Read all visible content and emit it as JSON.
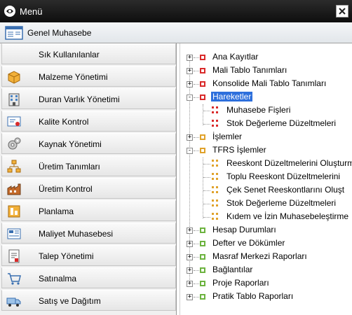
{
  "window": {
    "title": "Menü"
  },
  "header": {
    "title": "Genel Muhasebe",
    "icon": "ledger-icon"
  },
  "left_menu": {
    "items": [
      {
        "label": "Sık Kullanılanlar",
        "icon": ""
      },
      {
        "label": "Malzeme Yönetimi",
        "icon": "box-icon"
      },
      {
        "label": "Duran Varlık Yönetimi",
        "icon": "building-icon"
      },
      {
        "label": "Kalite Kontrol",
        "icon": "certificate-icon"
      },
      {
        "label": "Kaynak Yönetimi",
        "icon": "gears-icon"
      },
      {
        "label": "Üretim Tanımları",
        "icon": "flowchart-icon"
      },
      {
        "label": "Üretim Kontrol",
        "icon": "factory-icon"
      },
      {
        "label": "Planlama",
        "icon": "planning-icon"
      },
      {
        "label": "Maliyet Muhasebesi",
        "icon": "calculator-icon"
      },
      {
        "label": "Talep Yönetimi",
        "icon": "request-form-icon"
      },
      {
        "label": "Satınalma",
        "icon": "cart-icon"
      },
      {
        "label": "Satış ve Dağıtım",
        "icon": "truck-icon"
      }
    ]
  },
  "tree": {
    "nodes": [
      {
        "label": "Ana Kayıtlar",
        "expander": "+",
        "color": "#d92a2a"
      },
      {
        "label": "Mali Tablo Tanımları",
        "expander": "+",
        "color": "#d92a2a"
      },
      {
        "label": "Konsolide Mali Tablo Tanımları",
        "expander": "+",
        "color": "#d92a2a"
      },
      {
        "label": "Hareketler",
        "expander": "-",
        "color": "#d92a2a",
        "selected": true
      },
      {
        "label": "Muhasebe Fişleri",
        "leaf": true,
        "color": "#d92a2a"
      },
      {
        "label": "Stok Değerleme Düzeltmeleri",
        "leaf": true,
        "color": "#d92a2a"
      },
      {
        "label": "İşlemler",
        "expander": "+",
        "color": "#e0a22b"
      },
      {
        "label": "TFRS İşlemler",
        "expander": "-",
        "color": "#e0a22b"
      },
      {
        "label": "Reeskont Düzeltmelerini Oluşturma",
        "leaf": true,
        "color": "#e0a22b"
      },
      {
        "label": "Toplu Reeskont Düzeltmelerini",
        "leaf": true,
        "color": "#e0a22b"
      },
      {
        "label": "Çek Senet Reeskontlarını Oluşt",
        "leaf": true,
        "color": "#e0a22b"
      },
      {
        "label": "Stok Değerleme Düzeltmeleri",
        "leaf": true,
        "color": "#e0a22b"
      },
      {
        "label": "Kıdem ve İzin Muhasebeleştirme",
        "leaf": true,
        "color": "#e0a22b"
      },
      {
        "label": "Hesap Durumları",
        "expander": "+",
        "color": "#6cb33f"
      },
      {
        "label": "Defter ve Dökümler",
        "expander": "+",
        "color": "#6cb33f"
      },
      {
        "label": "Masraf Merkezi Raporları",
        "expander": "+",
        "color": "#6cb33f"
      },
      {
        "label": "Bağlantılar",
        "expander": "+",
        "color": "#6cb33f"
      },
      {
        "label": "Proje Raporları",
        "expander": "+",
        "color": "#6cb33f"
      },
      {
        "label": "Pratik Tablo Raporları",
        "expander": "+",
        "color": "#6cb33f"
      }
    ]
  },
  "colors": {
    "selection": "#2d6fdc",
    "red": "#d92a2a",
    "yellow": "#e0a22b",
    "green": "#6cb33f"
  }
}
